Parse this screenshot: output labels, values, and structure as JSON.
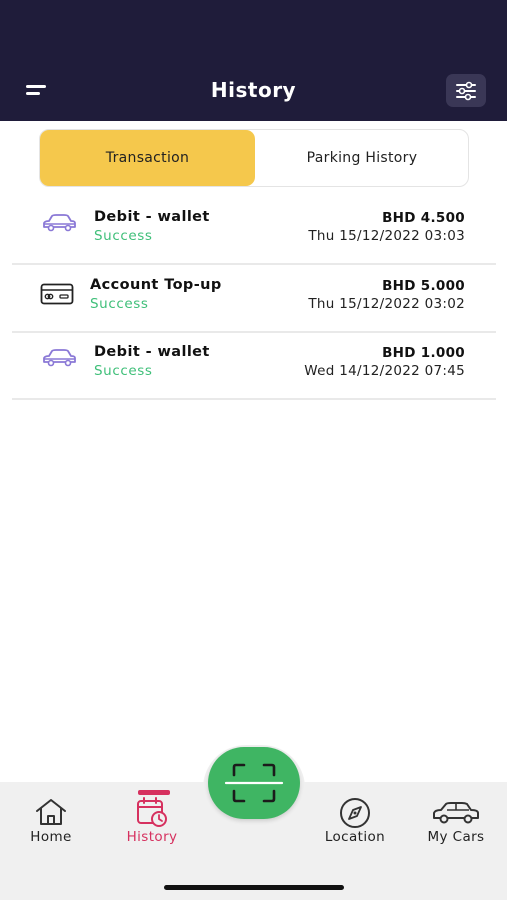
{
  "header": {
    "title": "History",
    "menu_icon": "hamburger-menu-icon",
    "filter_icon": "sliders-filter-icon"
  },
  "tabs": [
    {
      "label": "Transaction",
      "active": true
    },
    {
      "label": "Parking History",
      "active": false
    }
  ],
  "transactions": [
    {
      "icon": "car-icon",
      "title": "Debit - wallet",
      "status": "Success",
      "amount": "BHD 4.500",
      "date": "Thu 15/12/2022 03:03"
    },
    {
      "icon": "credit-card-icon",
      "title": "Account Top-up",
      "status": "Success",
      "amount": "BHD 5.000",
      "date": "Thu 15/12/2022 03:02"
    },
    {
      "icon": "car-icon",
      "title": "Debit - wallet",
      "status": "Success",
      "amount": "BHD 1.000",
      "date": "Wed 14/12/2022 07:45"
    }
  ],
  "bottom_nav": [
    {
      "label": "Home",
      "icon": "home-icon",
      "active": false
    },
    {
      "label": "History",
      "icon": "calendar-clock-icon",
      "active": true
    },
    {
      "label": "Location",
      "icon": "compass-icon",
      "active": false
    },
    {
      "label": "My Cars",
      "icon": "car-icon",
      "active": false
    }
  ],
  "scan_button_icon": "scan-icon",
  "colors": {
    "header_bg": "#1f1c3a",
    "active_tab": "#f5c84c",
    "success": "#3fbf79",
    "accent": "#d6315f",
    "scan_button": "#3fb563",
    "car_icon": "#8a78d6"
  }
}
